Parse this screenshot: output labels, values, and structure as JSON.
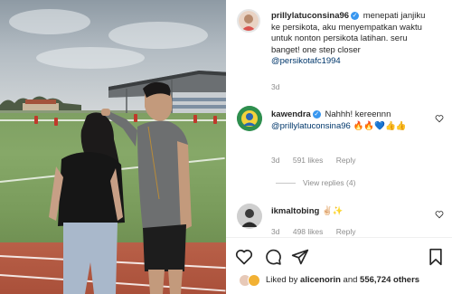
{
  "post": {
    "author": "prillylatuconsina96",
    "caption": "menepati janjiku ke persikota, aku menyempatkan waktu untuk nonton persikota latihan. seru banget! one step closer",
    "caption_mention": "@persikotafc1994",
    "time": "3d"
  },
  "comments": [
    {
      "author": "kawendra",
      "text": "Nahhh! kereennn",
      "mention": "@prillylatuconsina96",
      "emoji": "🔥🔥💙👍👍",
      "time": "3d",
      "likes": "591 likes",
      "reply_label": "Reply",
      "view_replies": "View replies (4)"
    },
    {
      "author": "ikmaltobing",
      "text": "✌🏻✨",
      "time": "3d",
      "likes": "498 likes",
      "reply_label": "Reply"
    }
  ],
  "footer": {
    "liked_by_prefix": "Liked by",
    "liked_by_user": "alicenorin",
    "and_label": "and",
    "others_count": "556,724 others"
  },
  "icons": {
    "verified": "verified-badge-icon",
    "heart": "heart-icon",
    "comment": "comment-icon",
    "share": "share-icon",
    "save": "bookmark-icon"
  },
  "colors": {
    "accent": "#3897f0",
    "mention": "#00376b",
    "muted": "#8e8e8e"
  }
}
